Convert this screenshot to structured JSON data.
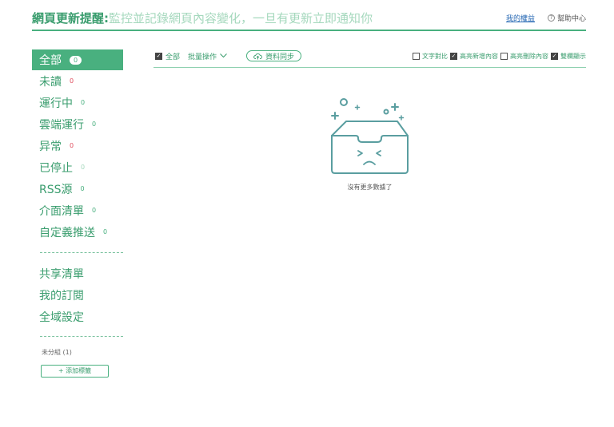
{
  "header": {
    "title_strong": "網頁更新提醒:",
    "title_light": "監控並記錄網頁內容變化，一旦有更新立即通知你",
    "rights_link": "我的權益",
    "help_icon_glyph": "?",
    "help_label": "幫助中心"
  },
  "sidebar": {
    "items": [
      {
        "label": "全部",
        "count": "0"
      },
      {
        "label": "未讀",
        "count": "0"
      },
      {
        "label": "運行中",
        "count": "0"
      },
      {
        "label": "雲端運行",
        "count": "0"
      },
      {
        "label": "异常",
        "count": "0"
      },
      {
        "label": "已停止",
        "count": "0"
      },
      {
        "label": "RSS源",
        "count": "0"
      },
      {
        "label": "介面清單",
        "count": "0"
      },
      {
        "label": "自定義推送",
        "count": "0"
      }
    ],
    "shared": [
      {
        "label": "共享清單"
      },
      {
        "label": "我的訂閱"
      },
      {
        "label": "全域設定"
      }
    ],
    "group_label": "未分組 (1)",
    "add_tag": "+ 添加標籤"
  },
  "toolbar": {
    "select_all": "全部",
    "batch": "批量操作",
    "sync": "資料同步",
    "options": [
      {
        "label": "文字對比",
        "checked": false
      },
      {
        "label": "高亮新增內容",
        "checked": true
      },
      {
        "label": "高亮刪除內容",
        "checked": false
      },
      {
        "label": "雙欄顯示",
        "checked": true
      }
    ]
  },
  "empty": {
    "message": "沒有更多數據了"
  },
  "colors": {
    "accent": "#49b07f",
    "accent_text": "#3a9d6e",
    "accent_light": "#a5d8bd",
    "alert_red": "#e04f5f",
    "link_blue": "#2a6bb5",
    "illustration": "#5a9ea0"
  }
}
